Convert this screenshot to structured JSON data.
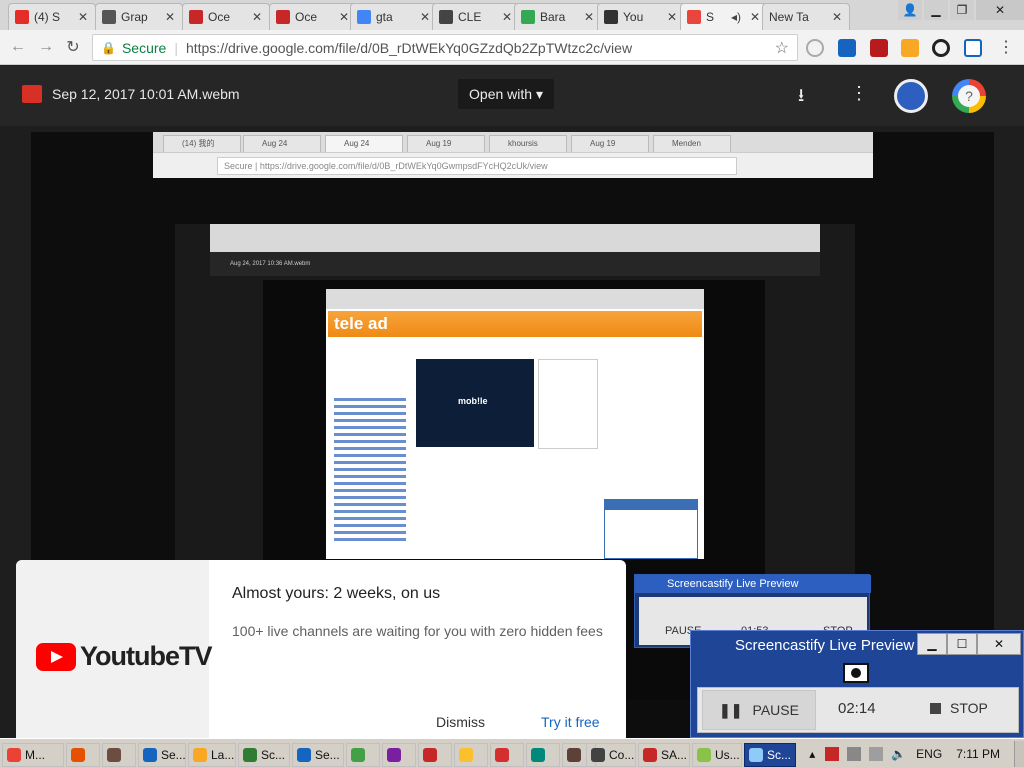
{
  "tabs": [
    {
      "label": "(4) S",
      "color": "#e52d27"
    },
    {
      "label": "Grap",
      "color": "#555555"
    },
    {
      "label": "Oce",
      "color": "#c62828"
    },
    {
      "label": "Oce",
      "color": "#c62828"
    },
    {
      "label": "gta",
      "color": "#4285f4"
    },
    {
      "label": "CLE",
      "color": "#444444"
    },
    {
      "label": "Bara",
      "color": "#34a853"
    },
    {
      "label": "You",
      "color": "#333333"
    },
    {
      "label": "S",
      "color": "#e8453c"
    },
    {
      "label": "New Ta",
      "color": "#dddddd"
    }
  ],
  "address": {
    "secure": "Secure",
    "url": "https://drive.google.com/file/d/0B_rDtWEkYq0GZzdQb2ZpTWtzc2c/view"
  },
  "drive": {
    "filename": "Sep 12, 2017 10:01 AM.webm",
    "open_with": "Open with"
  },
  "inner_capture": {
    "tabs": [
      "(14) 我的",
      "Aug 24",
      "Aug 24",
      "Aug 19",
      "khoursis",
      "Aug 19",
      "Menden"
    ],
    "url": "Secure | https://drive.google.com/file/d/0B_rDtWEkYq0GwmpsdFYcHQ2cUk/view",
    "filename": "Aug 24, 2017 10:36 AM.webm",
    "site_logo": "tele ad",
    "video_text": "mob!le"
  },
  "promo": {
    "brand": "YoutubeTV",
    "headline": "Almost yours: 2 weeks, on us",
    "subtext": "100+ live channels are waiting for you with zero hidden fees",
    "dismiss": "Dismiss",
    "cta": "Try it free"
  },
  "screencastify_back": {
    "title": "Screencastify Live Preview",
    "pause": "PAUSE",
    "time": "01:53",
    "stop": "STOP"
  },
  "screencastify": {
    "title": "Screencastify Live Preview",
    "pause": "PAUSE",
    "time": "02:14",
    "stop": "STOP"
  },
  "taskbar": {
    "items": [
      "M...",
      "",
      "",
      "Se...",
      "La...",
      "Sc...",
      "Se...",
      "",
      "",
      "",
      "",
      "",
      "",
      "",
      "Co...",
      "",
      "SA...",
      "Us...",
      "Sc..."
    ],
    "lang": "ENG",
    "clock": "7:11 PM"
  }
}
